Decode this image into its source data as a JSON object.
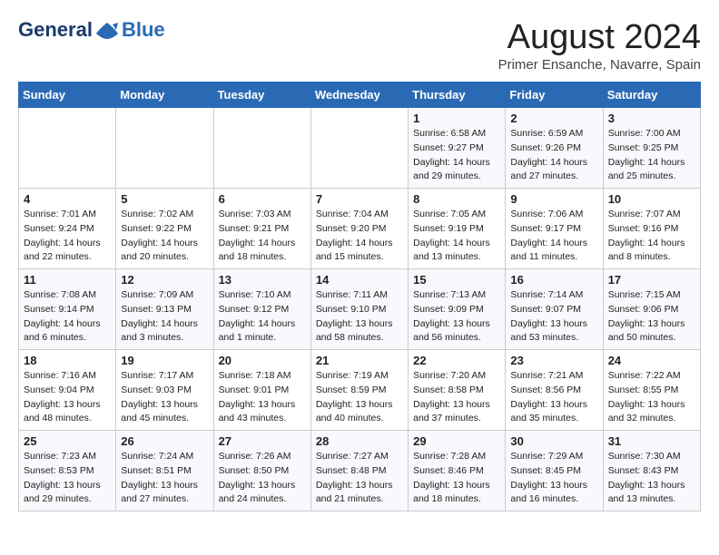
{
  "header": {
    "logo_line1": "General",
    "logo_line2": "Blue",
    "month": "August 2024",
    "location": "Primer Ensanche, Navarre, Spain"
  },
  "weekdays": [
    "Sunday",
    "Monday",
    "Tuesday",
    "Wednesday",
    "Thursday",
    "Friday",
    "Saturday"
  ],
  "weeks": [
    [
      {
        "day": "",
        "info": ""
      },
      {
        "day": "",
        "info": ""
      },
      {
        "day": "",
        "info": ""
      },
      {
        "day": "",
        "info": ""
      },
      {
        "day": "1",
        "info": "Sunrise: 6:58 AM\nSunset: 9:27 PM\nDaylight: 14 hours\nand 29 minutes."
      },
      {
        "day": "2",
        "info": "Sunrise: 6:59 AM\nSunset: 9:26 PM\nDaylight: 14 hours\nand 27 minutes."
      },
      {
        "day": "3",
        "info": "Sunrise: 7:00 AM\nSunset: 9:25 PM\nDaylight: 14 hours\nand 25 minutes."
      }
    ],
    [
      {
        "day": "4",
        "info": "Sunrise: 7:01 AM\nSunset: 9:24 PM\nDaylight: 14 hours\nand 22 minutes."
      },
      {
        "day": "5",
        "info": "Sunrise: 7:02 AM\nSunset: 9:22 PM\nDaylight: 14 hours\nand 20 minutes."
      },
      {
        "day": "6",
        "info": "Sunrise: 7:03 AM\nSunset: 9:21 PM\nDaylight: 14 hours\nand 18 minutes."
      },
      {
        "day": "7",
        "info": "Sunrise: 7:04 AM\nSunset: 9:20 PM\nDaylight: 14 hours\nand 15 minutes."
      },
      {
        "day": "8",
        "info": "Sunrise: 7:05 AM\nSunset: 9:19 PM\nDaylight: 14 hours\nand 13 minutes."
      },
      {
        "day": "9",
        "info": "Sunrise: 7:06 AM\nSunset: 9:17 PM\nDaylight: 14 hours\nand 11 minutes."
      },
      {
        "day": "10",
        "info": "Sunrise: 7:07 AM\nSunset: 9:16 PM\nDaylight: 14 hours\nand 8 minutes."
      }
    ],
    [
      {
        "day": "11",
        "info": "Sunrise: 7:08 AM\nSunset: 9:14 PM\nDaylight: 14 hours\nand 6 minutes."
      },
      {
        "day": "12",
        "info": "Sunrise: 7:09 AM\nSunset: 9:13 PM\nDaylight: 14 hours\nand 3 minutes."
      },
      {
        "day": "13",
        "info": "Sunrise: 7:10 AM\nSunset: 9:12 PM\nDaylight: 14 hours\nand 1 minute."
      },
      {
        "day": "14",
        "info": "Sunrise: 7:11 AM\nSunset: 9:10 PM\nDaylight: 13 hours\nand 58 minutes."
      },
      {
        "day": "15",
        "info": "Sunrise: 7:13 AM\nSunset: 9:09 PM\nDaylight: 13 hours\nand 56 minutes."
      },
      {
        "day": "16",
        "info": "Sunrise: 7:14 AM\nSunset: 9:07 PM\nDaylight: 13 hours\nand 53 minutes."
      },
      {
        "day": "17",
        "info": "Sunrise: 7:15 AM\nSunset: 9:06 PM\nDaylight: 13 hours\nand 50 minutes."
      }
    ],
    [
      {
        "day": "18",
        "info": "Sunrise: 7:16 AM\nSunset: 9:04 PM\nDaylight: 13 hours\nand 48 minutes."
      },
      {
        "day": "19",
        "info": "Sunrise: 7:17 AM\nSunset: 9:03 PM\nDaylight: 13 hours\nand 45 minutes."
      },
      {
        "day": "20",
        "info": "Sunrise: 7:18 AM\nSunset: 9:01 PM\nDaylight: 13 hours\nand 43 minutes."
      },
      {
        "day": "21",
        "info": "Sunrise: 7:19 AM\nSunset: 8:59 PM\nDaylight: 13 hours\nand 40 minutes."
      },
      {
        "day": "22",
        "info": "Sunrise: 7:20 AM\nSunset: 8:58 PM\nDaylight: 13 hours\nand 37 minutes."
      },
      {
        "day": "23",
        "info": "Sunrise: 7:21 AM\nSunset: 8:56 PM\nDaylight: 13 hours\nand 35 minutes."
      },
      {
        "day": "24",
        "info": "Sunrise: 7:22 AM\nSunset: 8:55 PM\nDaylight: 13 hours\nand 32 minutes."
      }
    ],
    [
      {
        "day": "25",
        "info": "Sunrise: 7:23 AM\nSunset: 8:53 PM\nDaylight: 13 hours\nand 29 minutes."
      },
      {
        "day": "26",
        "info": "Sunrise: 7:24 AM\nSunset: 8:51 PM\nDaylight: 13 hours\nand 27 minutes."
      },
      {
        "day": "27",
        "info": "Sunrise: 7:26 AM\nSunset: 8:50 PM\nDaylight: 13 hours\nand 24 minutes."
      },
      {
        "day": "28",
        "info": "Sunrise: 7:27 AM\nSunset: 8:48 PM\nDaylight: 13 hours\nand 21 minutes."
      },
      {
        "day": "29",
        "info": "Sunrise: 7:28 AM\nSunset: 8:46 PM\nDaylight: 13 hours\nand 18 minutes."
      },
      {
        "day": "30",
        "info": "Sunrise: 7:29 AM\nSunset: 8:45 PM\nDaylight: 13 hours\nand 16 minutes."
      },
      {
        "day": "31",
        "info": "Sunrise: 7:30 AM\nSunset: 8:43 PM\nDaylight: 13 hours\nand 13 minutes."
      }
    ]
  ]
}
